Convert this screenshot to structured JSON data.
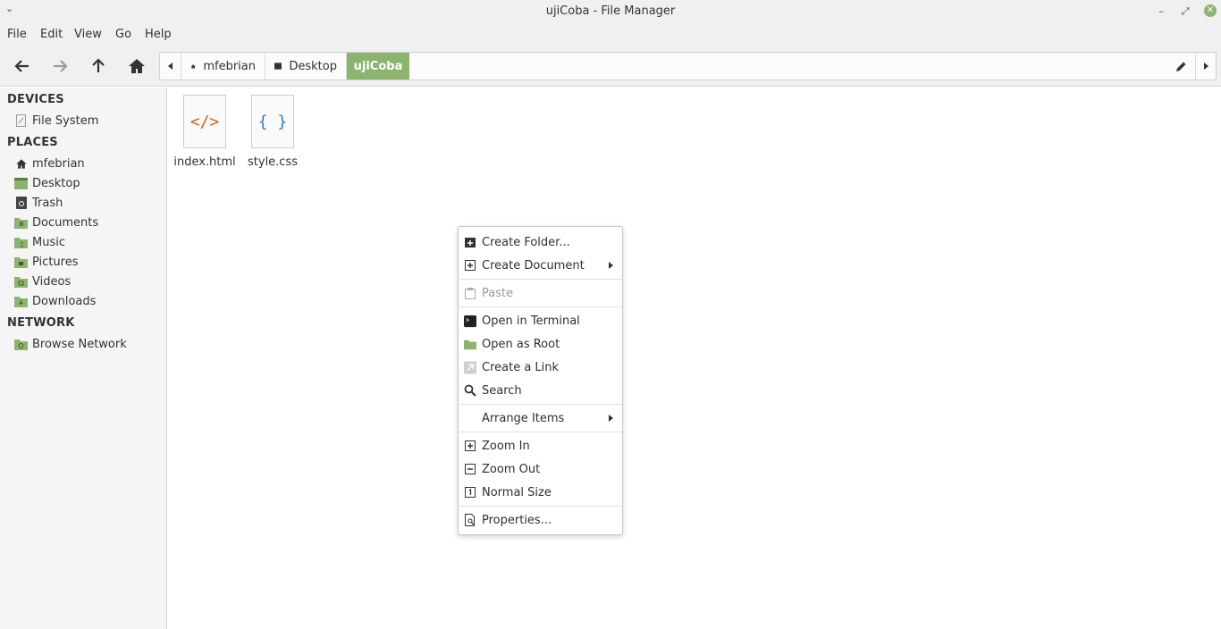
{
  "window": {
    "title": "ujiCoba - File Manager"
  },
  "menubar": [
    "File",
    "Edit",
    "View",
    "Go",
    "Help"
  ],
  "pathbar": {
    "crumbs": [
      "mfebrian",
      "Desktop",
      "ujiCoba"
    ]
  },
  "sidebar": {
    "devices_header": "DEVICES",
    "devices": [
      "File System"
    ],
    "places_header": "PLACES",
    "places": [
      "mfebrian",
      "Desktop",
      "Trash",
      "Documents",
      "Music",
      "Pictures",
      "Videos",
      "Downloads"
    ],
    "network_header": "NETWORK",
    "network": [
      "Browse Network"
    ]
  },
  "files": [
    {
      "name": "index.html",
      "glyph": "</>",
      "color": "#e05a1c"
    },
    {
      "name": "style.css",
      "glyph": "{ }",
      "color": "#2a7bd6"
    }
  ],
  "context_menu": {
    "items": [
      "Create Folder...",
      "Create Document",
      "Paste",
      "Open in Terminal",
      "Open as Root",
      "Create a Link",
      "Search",
      "Arrange Items",
      "Zoom In",
      "Zoom Out",
      "Normal Size",
      "Properties..."
    ]
  },
  "colors": {
    "accent": "#8cb46f",
    "folder": "#8cb46f"
  }
}
